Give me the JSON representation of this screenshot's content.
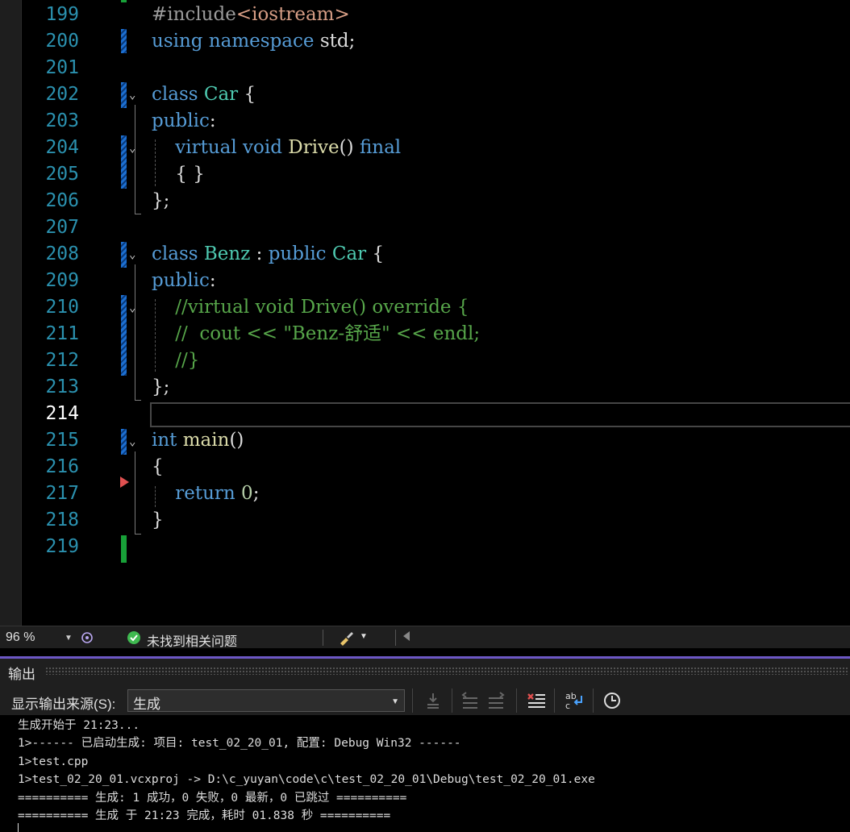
{
  "editor": {
    "lines": [
      {
        "num": "199",
        "tokens": [
          {
            "t": "#include",
            "c": "pp"
          },
          {
            "t": "<iostream>",
            "c": "str"
          }
        ]
      },
      {
        "num": "200",
        "tokens": [
          {
            "t": "using",
            "c": "kw"
          },
          {
            "t": " ",
            "c": ""
          },
          {
            "t": "namespace",
            "c": "kw"
          },
          {
            "t": " std;",
            "c": ""
          }
        ]
      },
      {
        "num": "201",
        "tokens": []
      },
      {
        "num": "202",
        "tokens": [
          {
            "t": "class",
            "c": "kw"
          },
          {
            "t": " ",
            "c": ""
          },
          {
            "t": "Car",
            "c": "type"
          },
          {
            "t": " {",
            "c": ""
          }
        ]
      },
      {
        "num": "203",
        "tokens": [
          {
            "t": "public",
            "c": "kw"
          },
          {
            "t": ":",
            "c": ""
          }
        ]
      },
      {
        "num": "204",
        "tokens": [
          {
            "t": "    ",
            "c": ""
          },
          {
            "t": "virtual",
            "c": "kw"
          },
          {
            "t": " ",
            "c": ""
          },
          {
            "t": "void",
            "c": "kw"
          },
          {
            "t": " ",
            "c": ""
          },
          {
            "t": "Drive",
            "c": "fn"
          },
          {
            "t": "() ",
            "c": ""
          },
          {
            "t": "final",
            "c": "kw"
          }
        ]
      },
      {
        "num": "205",
        "tokens": [
          {
            "t": "    { }",
            "c": ""
          }
        ]
      },
      {
        "num": "206",
        "tokens": [
          {
            "t": "};",
            "c": ""
          }
        ]
      },
      {
        "num": "207",
        "tokens": []
      },
      {
        "num": "208",
        "tokens": [
          {
            "t": "class",
            "c": "kw"
          },
          {
            "t": " ",
            "c": ""
          },
          {
            "t": "Benz",
            "c": "type"
          },
          {
            "t": " : ",
            "c": ""
          },
          {
            "t": "public",
            "c": "kw"
          },
          {
            "t": " ",
            "c": ""
          },
          {
            "t": "Car",
            "c": "type"
          },
          {
            "t": " {",
            "c": ""
          }
        ]
      },
      {
        "num": "209",
        "tokens": [
          {
            "t": "public",
            "c": "kw"
          },
          {
            "t": ":",
            "c": ""
          }
        ]
      },
      {
        "num": "210",
        "tokens": [
          {
            "t": "    ",
            "c": ""
          },
          {
            "t": "//virtual void Drive() override {",
            "c": "cm"
          }
        ]
      },
      {
        "num": "211",
        "tokens": [
          {
            "t": "    ",
            "c": ""
          },
          {
            "t": "//  cout << \"Benz-舒适\" << endl;",
            "c": "cm"
          }
        ]
      },
      {
        "num": "212",
        "tokens": [
          {
            "t": "    ",
            "c": ""
          },
          {
            "t": "//}",
            "c": "cm"
          }
        ]
      },
      {
        "num": "213",
        "tokens": [
          {
            "t": "};",
            "c": ""
          }
        ]
      },
      {
        "num": "214",
        "tokens": [],
        "current": true
      },
      {
        "num": "215",
        "tokens": [
          {
            "t": "int",
            "c": "kw"
          },
          {
            "t": " ",
            "c": ""
          },
          {
            "t": "main",
            "c": "fn"
          },
          {
            "t": "()",
            "c": ""
          }
        ]
      },
      {
        "num": "216",
        "tokens": [
          {
            "t": "{",
            "c": ""
          }
        ]
      },
      {
        "num": "217",
        "tokens": [
          {
            "t": "    ",
            "c": ""
          },
          {
            "t": "return",
            "c": "kw"
          },
          {
            "t": " ",
            "c": ""
          },
          {
            "t": "0",
            "c": "num"
          },
          {
            "t": ";",
            "c": ""
          }
        ]
      },
      {
        "num": "218",
        "tokens": [
          {
            "t": "}",
            "c": ""
          }
        ]
      },
      {
        "num": "219",
        "tokens": []
      }
    ]
  },
  "status_bar": {
    "zoom": "96 %",
    "issues_text": "未找到相关问题"
  },
  "output_panel": {
    "title": "输出",
    "source_label": "显示输出来源(S):",
    "source_value": "生成",
    "lines": [
      "生成开始于 21:23...",
      "1>------ 已启动生成: 项目: test_02_20_01, 配置: Debug Win32 ------",
      "1>test.cpp",
      "1>test_02_20_01.vcxproj -> D:\\c_yuyan\\code\\c\\test_02_20_01\\Debug\\test_02_20_01.exe",
      "========== 生成: 1 成功，0 失败，0 最新，0 已跳过 ==========",
      "========== 生成 于 21:23 完成，耗时 01.838 秒 =========="
    ]
  },
  "colors": {
    "keyword": "#569cd6",
    "type": "#4ec9b0",
    "function": "#dcdcaa",
    "comment": "#57a64a",
    "line_number": "#2b91af",
    "accent": "#6c57c4",
    "success": "#3fb950",
    "breakpoint_arrow": "#e05050"
  }
}
